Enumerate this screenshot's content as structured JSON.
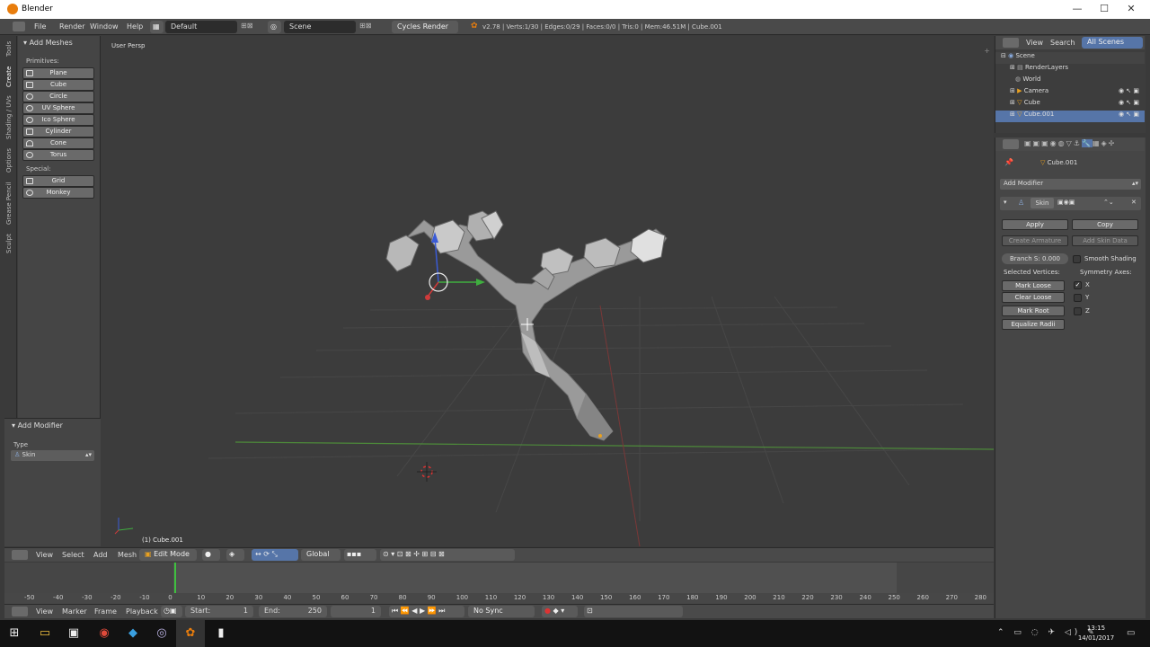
{
  "window": {
    "title": "Blender",
    "minimize": "—",
    "maximize": "☐",
    "close": "✕"
  },
  "menu": {
    "file": "File",
    "render": "Render",
    "window": "Window",
    "help": "Help"
  },
  "layout": {
    "value": "Default"
  },
  "scene": {
    "value": "Scene"
  },
  "engine": {
    "value": "Cycles Render"
  },
  "stats": "v2.78 | Verts:1/30 | Edges:0/29 | Faces:0/0 | Tris:0 | Mem:46.51M | Cube.001",
  "tabs": [
    "Tools",
    "Create",
    "Shading / UVs",
    "Options",
    "Grease Pencil",
    "Sculpt"
  ],
  "add_meshes": {
    "header": "Add Meshes",
    "primitives_label": "Primitives:",
    "special_label": "Special:",
    "primitives": [
      "Plane",
      "Cube",
      "Circle",
      "UV Sphere",
      "Ico Sphere",
      "Cylinder",
      "Cone",
      "Torus"
    ],
    "special": [
      "Grid",
      "Monkey"
    ]
  },
  "operator": {
    "header": "Add Modifier",
    "type_label": "Type",
    "type_value": "Skin"
  },
  "viewport": {
    "label": "User Persp",
    "object": "(1) Cube.001"
  },
  "view_header": {
    "view": "View",
    "select": "Select",
    "add": "Add",
    "mesh": "Mesh",
    "mode": "Edit Mode",
    "orientation": "Global"
  },
  "timeline": {
    "ticks": [
      "-50",
      "-40",
      "-30",
      "-20",
      "-10",
      "0",
      "10",
      "20",
      "30",
      "40",
      "50",
      "60",
      "70",
      "80",
      "90",
      "100",
      "110",
      "120",
      "130",
      "140",
      "150",
      "160",
      "170",
      "180",
      "190",
      "200",
      "210",
      "220",
      "230",
      "240",
      "250",
      "260",
      "270",
      "280"
    ],
    "view": "View",
    "marker": "Marker",
    "frame": "Frame",
    "playback": "Playback",
    "start_label": "Start:",
    "start": "1",
    "end_label": "End:",
    "end": "250",
    "current": "1",
    "sync": "No Sync"
  },
  "outliner": {
    "view": "View",
    "search": "Search",
    "filter": "All Scenes",
    "items": [
      "Scene",
      "RenderLayers",
      "World",
      "Camera",
      "Cube",
      "Cube.001"
    ]
  },
  "properties": {
    "context": "Cube.001",
    "add_modifier": "Add Modifier",
    "modifier_name": "Skin",
    "apply": "Apply",
    "copy": "Copy",
    "create_armature": "Create Armature",
    "add_skin_data": "Add Skin Data",
    "branch": "Branch S: 0.000",
    "smooth": "Smooth Shading",
    "selected_vertices": "Selected Vertices:",
    "symmetry_axes": "Symmetry Axes:",
    "mark_loose": "Mark Loose",
    "clear_loose": "Clear Loose",
    "mark_root": "Mark Root",
    "equalize": "Equalize Radii",
    "axes": [
      "X",
      "Y",
      "Z"
    ]
  },
  "taskbar": {
    "time": "13:15",
    "date": "14/01/2017"
  }
}
